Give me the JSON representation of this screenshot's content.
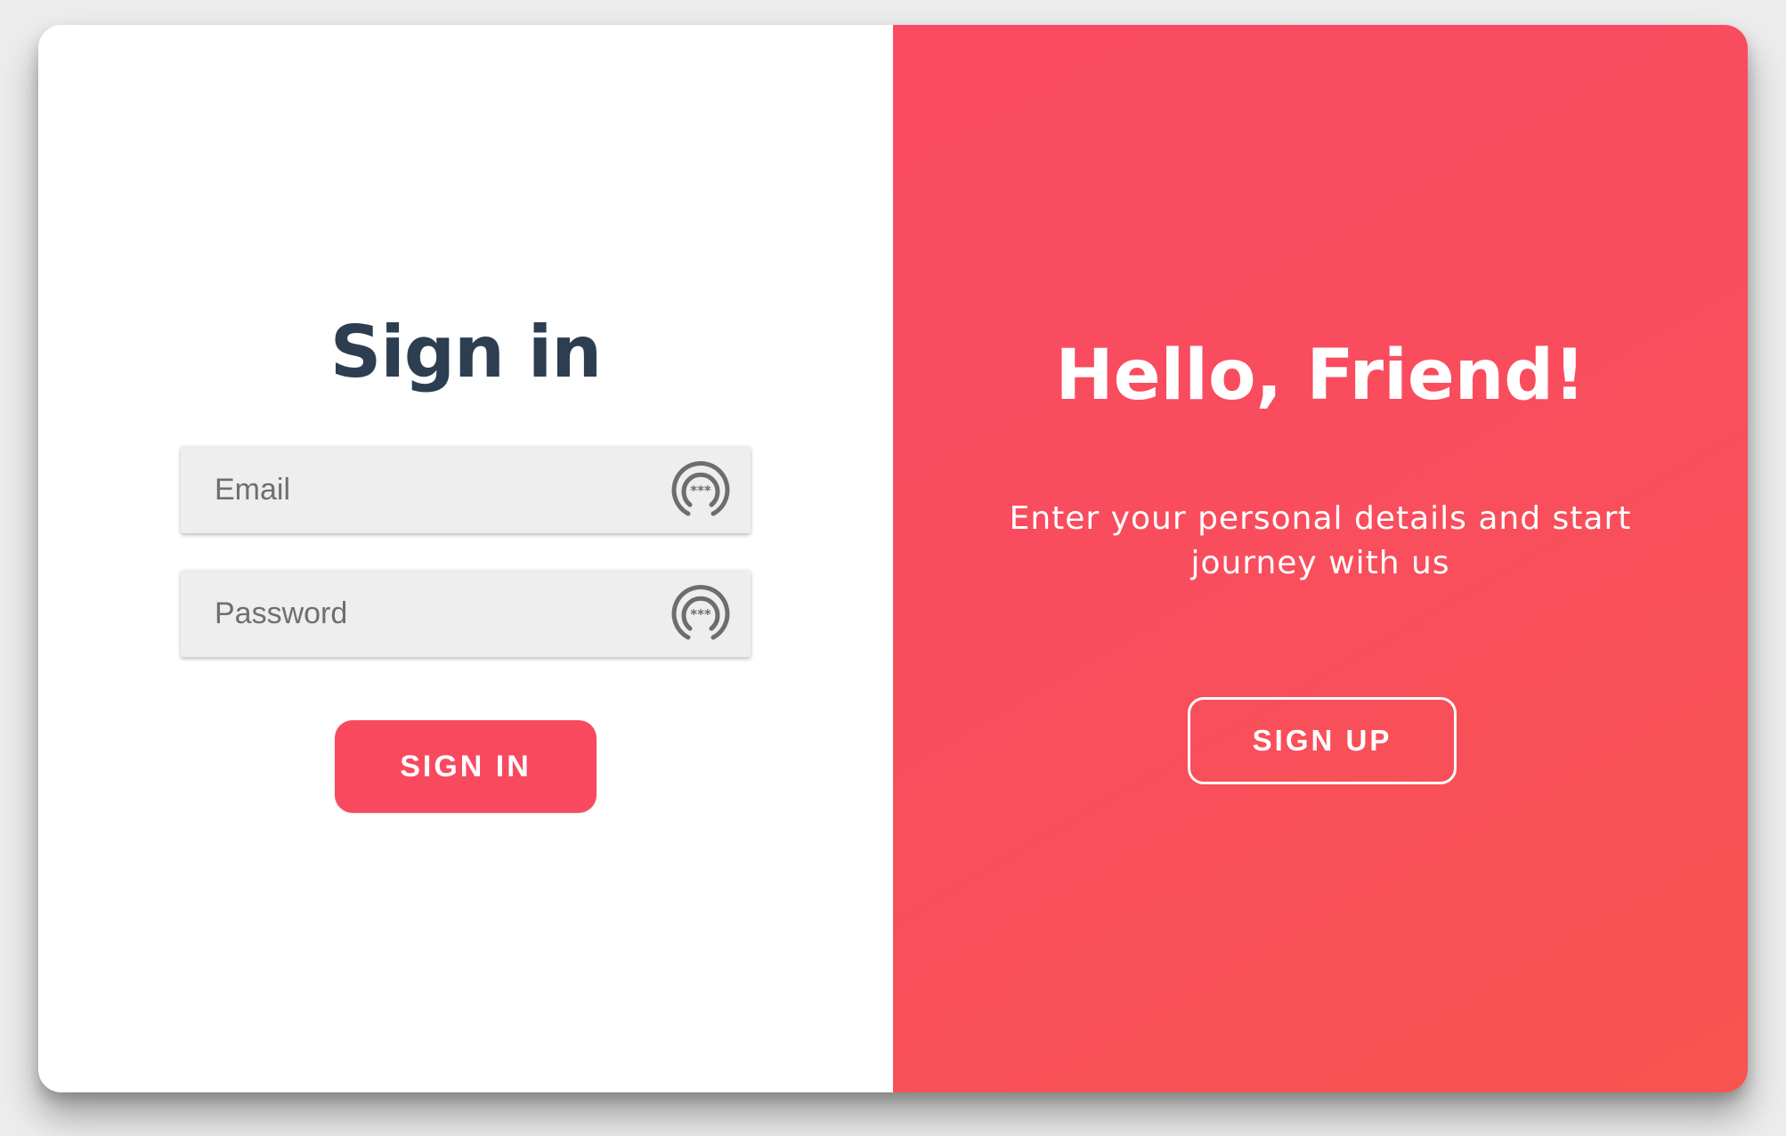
{
  "signin": {
    "title": "Sign in",
    "email": {
      "placeholder": "Email",
      "value": ""
    },
    "password": {
      "placeholder": "Password",
      "value": ""
    },
    "field_icon": "password-manager-icon",
    "button_label": "SIGN IN"
  },
  "welcome": {
    "title": "Hello, Friend!",
    "text": "Enter your personal details and start journey with us",
    "button_label": "SIGN UP"
  },
  "colors": {
    "accent": "#f9495f",
    "title_text": "#2c3e50",
    "field_background": "#eeeeee",
    "panel_gradient_start": "#f94a62",
    "panel_gradient_end": "#f8544f"
  }
}
